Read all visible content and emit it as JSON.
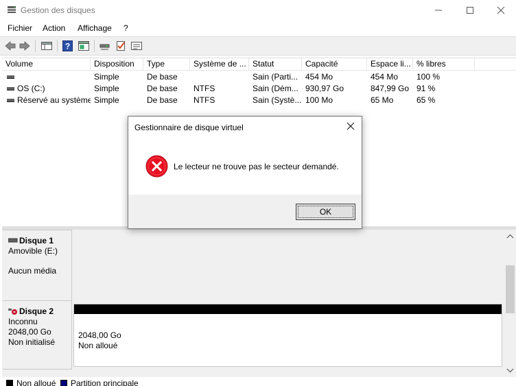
{
  "window": {
    "title": "Gestion des disques"
  },
  "menu": [
    "Fichier",
    "Action",
    "Affichage",
    "?"
  ],
  "toolbar_icons": [
    "back-arrow-icon",
    "forward-arrow-icon",
    "disk-list-icon",
    "help-icon",
    "properties-icon",
    "connect-icon",
    "checklist-icon",
    "settings-panel-icon"
  ],
  "columns": [
    "Volume",
    "Disposition",
    "Type",
    "Système de ...",
    "Statut",
    "Capacité",
    "Espace li...",
    "% libres"
  ],
  "volumes": [
    {
      "volume": "",
      "disposition": "Simple",
      "type": "De base",
      "fs": "",
      "statut": "Sain (Parti...",
      "capacite": "454 Mo",
      "espace": "454 Mo",
      "libres": "100 %"
    },
    {
      "volume": "OS (C:)",
      "disposition": "Simple",
      "type": "De base",
      "fs": "NTFS",
      "statut": "Sain (Dém...",
      "capacite": "930,97 Go",
      "espace": "847,99 Go",
      "libres": "91 %"
    },
    {
      "volume": "Réservé au système",
      "disposition": "Simple",
      "type": "De base",
      "fs": "NTFS",
      "statut": "Sain (Systè...",
      "capacite": "100 Mo",
      "espace": "65 Mo",
      "libres": "65 %"
    }
  ],
  "disks": {
    "disk1": {
      "name": "Disque 1",
      "kind": "Amovible (E:)",
      "media": "Aucun média"
    },
    "disk2": {
      "name": "Disque 2",
      "status": "Inconnu",
      "size": "2048,00 Go",
      "init": "Non initialisé",
      "part_size": "2048,00 Go",
      "part_state": "Non alloué"
    }
  },
  "legend": {
    "unallocated": "Non alloué",
    "primary": "Partition principale",
    "unallocated_color": "#000000",
    "primary_color": "#00007f"
  },
  "dialog": {
    "title": "Gestionnaire de disque virtuel",
    "message": "Le lecteur ne trouve pas le secteur demandé.",
    "ok": "OK"
  }
}
